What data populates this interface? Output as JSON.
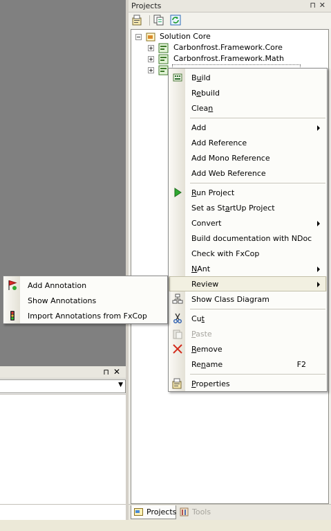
{
  "projects_pane": {
    "title": "Projects",
    "pin_glyph": "⊓",
    "close_glyph": "✕",
    "toolbar": [
      {
        "icon": "properties-icon"
      },
      {
        "icon": "show-all-files-icon"
      },
      {
        "icon": "refresh-icon"
      }
    ],
    "tree": [
      {
        "label": "Solution Core",
        "icon": "solution-icon",
        "expander": "minus",
        "indent": 0
      },
      {
        "label": "Carbonfrost.Framework.Core",
        "icon": "project-icon",
        "expander": "plus",
        "indent": 1
      },
      {
        "label": "Carbonfrost.Framework.Math",
        "icon": "project-icon",
        "expander": "plus",
        "indent": 1
      },
      {
        "label": "",
        "icon": "project-icon",
        "expander": "plus",
        "indent": 1
      }
    ],
    "tabs": [
      {
        "label": "Projects",
        "icon": "projects-tab-icon",
        "active": true
      },
      {
        "label": "Tools",
        "icon": "tools-tab-icon",
        "active": false
      }
    ]
  },
  "output_pane": {
    "pin_glyph": "⊓",
    "close_glyph": "✕",
    "combo_arrow": "▼"
  },
  "context_menu": {
    "items": [
      {
        "label": "Build",
        "accel_index": 1,
        "icon": "build-icon",
        "submenu": false
      },
      {
        "label": "Rebuild",
        "accel_index": 1,
        "submenu": false
      },
      {
        "label": "Clean",
        "accel_index": 4,
        "submenu": false
      },
      {
        "separator": true
      },
      {
        "label": "Add",
        "accel_index": -1,
        "submenu": true
      },
      {
        "label": "Add Reference",
        "accel_index": -1,
        "submenu": false
      },
      {
        "label": "Add Mono Reference",
        "accel_index": -1,
        "submenu": false
      },
      {
        "label": "Add Web Reference",
        "accel_index": -1,
        "submenu": false
      },
      {
        "separator": true
      },
      {
        "label": "Run Project",
        "accel_index": 0,
        "icon": "run-icon",
        "submenu": false
      },
      {
        "label": "Set as StartUp Project",
        "accel_index": 11,
        "submenu": false
      },
      {
        "label": "Convert",
        "accel_index": -1,
        "submenu": true
      },
      {
        "label": "Build documentation with NDoc",
        "accel_index": -1,
        "submenu": false
      },
      {
        "label": "Check with FxCop",
        "accel_index": -1,
        "submenu": false
      },
      {
        "label": "NAnt",
        "accel_index": 0,
        "submenu": true
      },
      {
        "label": "Review",
        "accel_index": -1,
        "submenu": true,
        "hover": true
      },
      {
        "label": "Show Class Diagram",
        "accel_index": -1,
        "icon": "class-diagram-icon",
        "submenu": false
      },
      {
        "separator": true
      },
      {
        "label": "Cut",
        "accel_index": 2,
        "icon": "cut-icon",
        "submenu": false
      },
      {
        "label": "Paste",
        "accel_index": 0,
        "icon": "paste-icon",
        "submenu": false,
        "disabled": true
      },
      {
        "label": "Remove",
        "accel_index": 0,
        "icon": "remove-icon",
        "submenu": false
      },
      {
        "label": "Rename",
        "accel_index": 2,
        "shortcut": "F2",
        "submenu": false
      },
      {
        "separator": true
      },
      {
        "label": "Properties",
        "accel_index": 0,
        "icon": "properties-icon",
        "submenu": false
      }
    ]
  },
  "review_submenu": {
    "items": [
      {
        "label": "Add Annotation",
        "icon": "add-annotation-icon"
      },
      {
        "label": "Show Annotations",
        "icon": ""
      },
      {
        "label": "Import Annotations from FxCop",
        "icon": "traffic-light-icon"
      }
    ]
  },
  "colors": {
    "document_area": "#808080",
    "menu_hover": "#eeecdd",
    "pane_background": "#f0efea"
  }
}
